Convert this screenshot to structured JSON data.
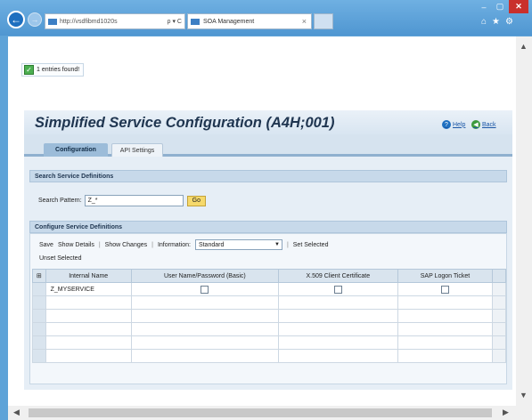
{
  "browser": {
    "address_url": "http://vsdfibmd1020s",
    "address_tools": "ρ ▾ C",
    "tab_title": "SOA Management",
    "tab_close": "×",
    "back_glyph": "←",
    "forward_glyph": "→",
    "minimize_glyph": "‒",
    "maximize_glyph": "▢",
    "close_glyph": "✕",
    "home_glyph": "⌂",
    "star_glyph": "★",
    "gear_glyph": "⚙"
  },
  "message": {
    "text": "1 entries found!",
    "check_glyph": "✓"
  },
  "header": {
    "title": "Simplified Service Configuration (A4H;001)",
    "help_label": "Help",
    "help_glyph": "?",
    "back_label": "Back",
    "back_glyph": "◀"
  },
  "tabs": [
    {
      "label": "Configuration",
      "active": true
    },
    {
      "label": "API Settings",
      "active": false
    }
  ],
  "search_section": {
    "title": "Search Service Definitions",
    "pattern_label": "Search Pattern:",
    "pattern_value": "Z_*",
    "go_label": "Go"
  },
  "config_section": {
    "title": "Configure Service Definitions",
    "toolbar": {
      "save": "Save",
      "show_details": "Show Details",
      "divider": "|",
      "show_changes": "Show Changes",
      "information_label": "Information:",
      "information_value": "Standard",
      "set_selected": "Set Selected",
      "unset_selected": "Unset Selected"
    },
    "table": {
      "columns": [
        "Internal Name",
        "User Name/Password (Basic)",
        "X.509 Client Certificate",
        "SAP Logon Ticket"
      ],
      "rows": [
        {
          "name": "Z_MYSERVICE",
          "basic": false,
          "x509": false,
          "logon_ticket": false
        }
      ]
    }
  },
  "scroll": {
    "up": "▲",
    "down": "▼",
    "left": "◀",
    "right": "▶",
    "select_all_glyph": "⊞"
  },
  "colors": {
    "window_frame": "#5ea3d8",
    "title_text": "#1f3550",
    "tab_active": "#9cbcd9",
    "go_button": "#f6d96b",
    "success": "#4caf50"
  }
}
